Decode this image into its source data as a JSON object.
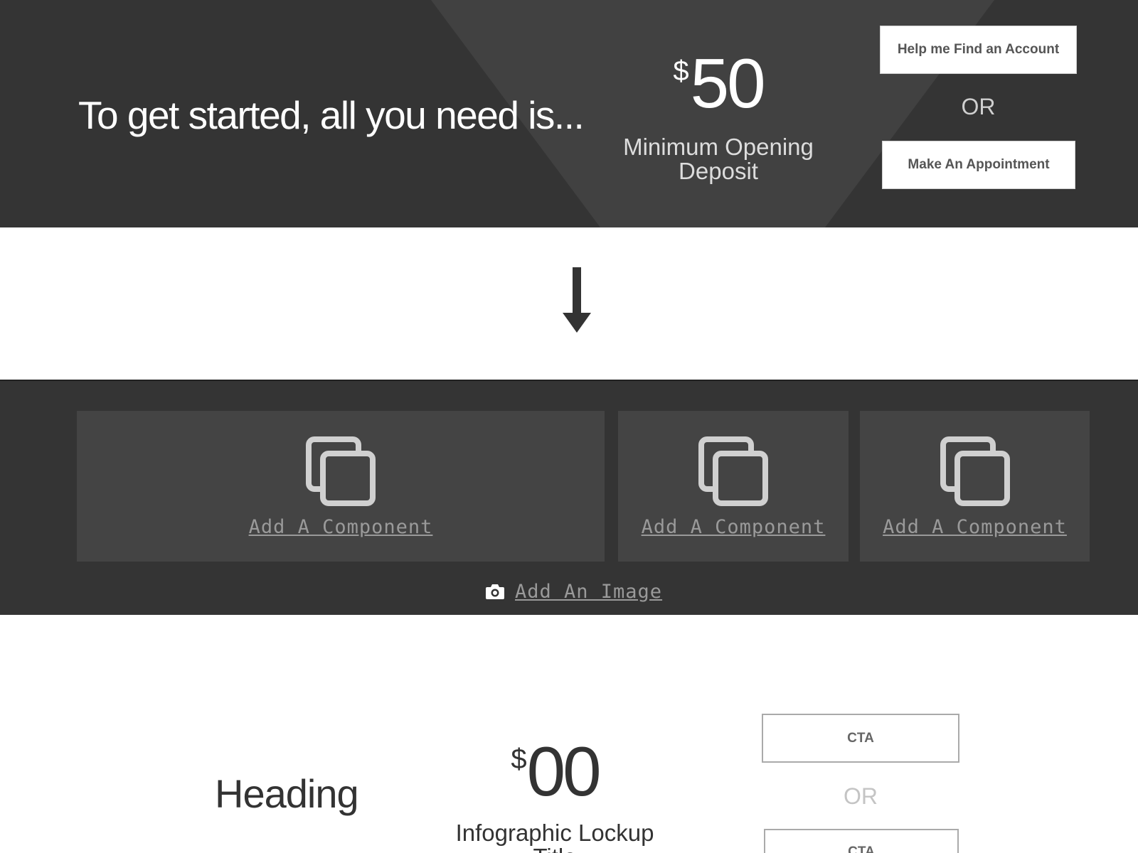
{
  "hero": {
    "title": "To get started, all you need is...",
    "price_currency": "$",
    "price_amount": "50",
    "price_caption": "Minimum Opening Deposit",
    "help_button": "Help me Find an Account",
    "or_text": "OR",
    "appointment_button": "Make An Appointment"
  },
  "components": {
    "slots": [
      {
        "label": "Add A Component",
        "icon": "copy-icon"
      },
      {
        "label": "Add A Component",
        "icon": "copy-icon"
      },
      {
        "label": "Add A Component",
        "icon": "copy-icon"
      }
    ],
    "add_image_label": "Add An Image",
    "add_image_icon": "camera-icon"
  },
  "lockup": {
    "heading": "Heading",
    "price_currency": "$",
    "price_amount": "00",
    "caption": "Infographic Lockup Title",
    "cta_primary": "CTA",
    "or_text": "OR",
    "cta_secondary": "CTA"
  },
  "colors": {
    "dark_band": "#343434",
    "slot_bg": "#444444",
    "placeholder_text": "#9a9a9a"
  }
}
